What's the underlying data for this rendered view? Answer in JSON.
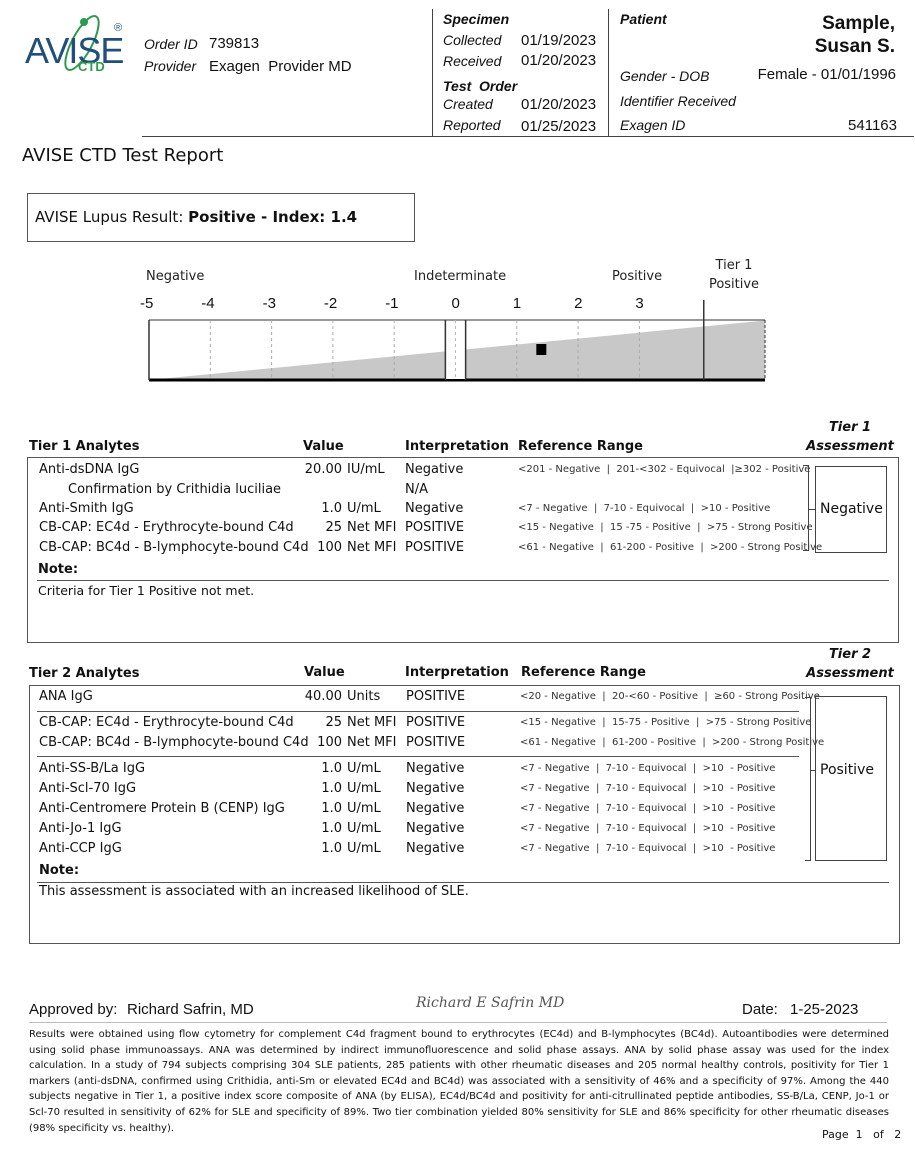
{
  "header": {
    "logo": {
      "main": "AVISE",
      "sub": "CTD",
      "reg": "®"
    },
    "order_id_label": "Order ID",
    "order_id": "739813",
    "provider_label": "Provider",
    "provider": "Exagen  Provider MD",
    "specimen": {
      "title": "Specimen",
      "collected_label": "Collected",
      "collected": "01/19/2023",
      "received_label": "Received",
      "received": "01/20/2023"
    },
    "test_order": {
      "title": "Test  Order",
      "created_label": "Created",
      "created": "01/20/2023",
      "reported_label": "Reported",
      "reported": "01/25/2023"
    },
    "patient": {
      "title": "Patient",
      "name_line1": "Sample,",
      "name_line2": "Susan S.",
      "gender_dob_label": "Gender - DOB",
      "gender_dob": "Female - 01/01/1996",
      "identifier_label": "Identifier Received",
      "exagen_id_label": "Exagen ID",
      "exagen_id": "541163"
    }
  },
  "report_title": "AVISE CTD Test Report",
  "result": {
    "label": "AVISE Lupus Result:",
    "value": "Positive - Index: 1.4"
  },
  "index_scale": {
    "zone_labels": {
      "negative": "Negative",
      "indeterminate": "Indeterminate",
      "positive": "Positive",
      "tier1_line1": "Tier 1",
      "tier1_line2": "Positive"
    },
    "ticks": [
      "-5",
      "-4",
      "-3",
      "-2",
      "-1",
      "0",
      "1",
      "2",
      "3"
    ],
    "range": [
      -5,
      5
    ],
    "indeterminate_range": [
      -0.1,
      0.1
    ],
    "tier1_threshold": 4.05,
    "marker_value": 1.4
  },
  "tier1": {
    "headers": {
      "analytes": "Tier 1 Analytes",
      "value": "Value",
      "interpretation": "Interpretation",
      "reference": "Reference Range",
      "assessment_line1": "Tier 1",
      "assessment_line2": "Assessment"
    },
    "rows": [
      {
        "name": "Anti-dsDNA IgG",
        "value": "20.00",
        "unit": "IU/mL",
        "interp": "Negative",
        "ref": "<201 - Negative  |  201-<302 - Equivocal  |≥302 - Positive"
      },
      {
        "name": "Confirmation by Crithidia luciliae",
        "value": "",
        "unit": "",
        "interp": "N/A",
        "ref": ""
      },
      {
        "name": "Anti-Smith IgG",
        "value": "1.0",
        "unit": "U/mL",
        "interp": "Negative",
        "ref": "<7 - Negative  |  7-10 - Equivocal  |  >10 - Positive"
      },
      {
        "name": "CB-CAP: EC4d - Erythrocyte-bound C4d",
        "value": "25",
        "unit": "Net MFI",
        "interp": "POSITIVE",
        "ref": "<15 - Negative  |  15 -75 - Positive  |  >75 - Strong Positive"
      },
      {
        "name": "CB-CAP: BC4d - B-lymphocyte-bound C4d",
        "value": "100",
        "unit": "Net MFI",
        "interp": "POSITIVE",
        "ref": "<61 - Negative  |  61-200 - Positive  |  >200 - Strong Positive"
      }
    ],
    "assessment": "Negative",
    "note_label": "Note:",
    "note": "Criteria for Tier 1 Positive not met."
  },
  "tier2": {
    "headers": {
      "analytes": "Tier 2 Analytes",
      "value": "Value",
      "interpretation": "Interpretation",
      "reference": "Reference Range",
      "assessment_line1": "Tier 2",
      "assessment_line2": "Assessment"
    },
    "rows": [
      {
        "name": "ANA IgG",
        "value": "40.00",
        "unit": "Units",
        "interp": "POSITIVE",
        "ref": "<20 - Negative  |  20-<60 - Positive  |  ≥60 - Strong Positive"
      },
      {
        "name": "CB-CAP: EC4d - Erythrocyte-bound C4d",
        "value": "25",
        "unit": "Net MFI",
        "interp": "POSITIVE",
        "ref": "<15 - Negative  |  15-75 - Positive  |  >75 - Strong Positive"
      },
      {
        "name": "CB-CAP: BC4d - B-lymphocyte-bound C4d",
        "value": "100",
        "unit": "Net MFI",
        "interp": "POSITIVE",
        "ref": "<61 - Negative  |  61-200 - Positive  |  >200 - Strong Positive"
      },
      {
        "name": "Anti-SS-B/La IgG",
        "value": "1.0",
        "unit": "U/mL",
        "interp": "Negative",
        "ref": "<7 - Negative  |  7-10 - Equivocal  |  >10  - Positive"
      },
      {
        "name": "Anti-Scl-70 IgG",
        "value": "1.0",
        "unit": "U/mL",
        "interp": "Negative",
        "ref": "<7 - Negative  |  7-10 - Equivocal  |  >10  - Positive"
      },
      {
        "name": "Anti-Centromere Protein B (CENP) IgG",
        "value": "1.0",
        "unit": "U/mL",
        "interp": "Negative",
        "ref": "<7 - Negative  |  7-10 - Equivocal  |  >10  - Positive"
      },
      {
        "name": "Anti-Jo-1 IgG",
        "value": "1.0",
        "unit": "U/mL",
        "interp": "Negative",
        "ref": "<7 - Negative  |  7-10 - Equivocal  |  >10  - Positive"
      },
      {
        "name": "Anti-CCP IgG",
        "value": "1.0",
        "unit": "U/mL",
        "interp": "Negative",
        "ref": "<7 - Negative  |  7-10 - Equivocal  |  >10  - Positive"
      }
    ],
    "assessment": "Positive",
    "note_label": "Note:",
    "note": "This assessment is associated with an increased likelihood of SLE."
  },
  "footer": {
    "approved_label": "Approved by:",
    "approved_by": "Richard Safrin, MD",
    "signature": "Richard E Safrin MD",
    "date_label": "Date:",
    "date": "1-25-2023",
    "disclaimer": "Results were obtained using flow cytometry for complement C4d fragment bound to erythrocytes (EC4d) and B-lymphocytes (BC4d). Autoantibodies were determined using solid phase immunoassays. ANA was determined by indirect immunofluorescence and solid phase assays. ANA by solid phase assay was used for the index calculation. In a study of 794 subjects comprising 304 SLE patients, 285 patients with other rheumatic diseases and 205 normal healthy controls, positivity for Tier 1 markers (anti-dsDNA, confirmed using Crithidia, anti-Sm or elevated EC4d and BC4d) was associated with a sensitivity of 46% and a specificity of 97%. Among the 440 subjects negative in Tier 1, a positive index score composite of ANA (by ELISA), EC4d/BC4d and positivity for anti-citrullinated peptide antibodies, SS-B/La, CENP, Jo-1 or Scl-70 resulted in sensitivity of 62% for SLE and specificity of 89%. Two tier combination yielded 80% sensitivity for SLE and 86% specificity for other rheumatic diseases (98% specificity vs. healthy).",
    "page_label": "Page  1   of   2"
  }
}
